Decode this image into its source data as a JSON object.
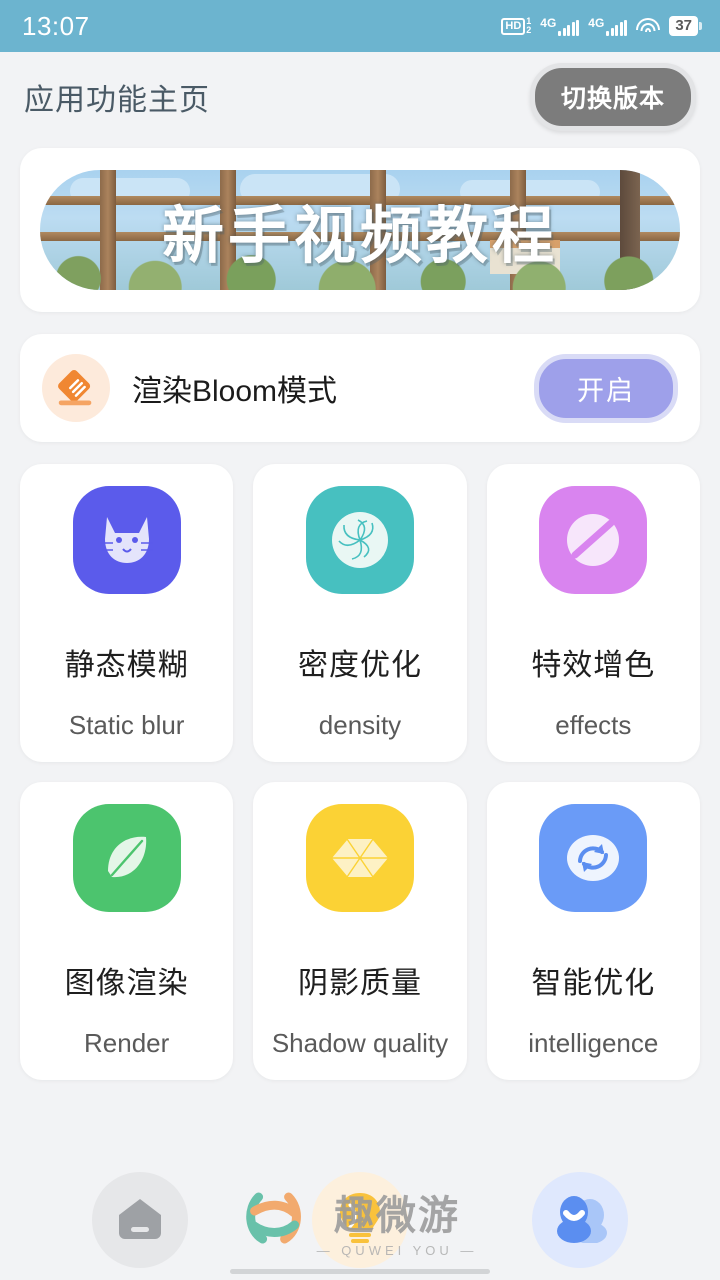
{
  "status_bar": {
    "time": "13:07",
    "hd_label": "HD",
    "hd_sup": "1",
    "hd_sub": "2",
    "sim1_network": "4G",
    "sim2_network": "4G",
    "wifi_icon": "wifi-icon",
    "battery_level": "37"
  },
  "header": {
    "title": "应用功能主页",
    "switch_version_label": "切换版本"
  },
  "banner": {
    "title": "新手视频教程"
  },
  "bloom_row": {
    "icon": "bloom-diamond-icon",
    "label": "渲染Bloom模式",
    "action_label": "开启"
  },
  "features": [
    {
      "icon": "cat-face-icon",
      "icon_color": "#5b5beb",
      "title": "静态模糊",
      "subtitle": "Static blur"
    },
    {
      "icon": "swirl-icon",
      "icon_color": "#47c0c0",
      "title": "密度优化",
      "subtitle": "density"
    },
    {
      "icon": "no-effects-icon",
      "icon_color": "#d984ef",
      "title": "特效增色",
      "subtitle": "effects"
    },
    {
      "icon": "leaf-icon",
      "icon_color": "#4cc46e",
      "title": "图像渲染",
      "subtitle": "Render"
    },
    {
      "icon": "gem-icon",
      "icon_color": "#fbd235",
      "title": "阴影质量",
      "subtitle": "Shadow quality"
    },
    {
      "icon": "sync-icon",
      "icon_color": "#6a9bf7",
      "title": "智能优化",
      "subtitle": "intelligence"
    }
  ],
  "bottom_nav": [
    {
      "icon": "home-icon",
      "name": "nav-home"
    },
    {
      "icon": "lightbulb-icon",
      "name": "nav-tips"
    },
    {
      "icon": "people-icon",
      "name": "nav-chat"
    }
  ],
  "watermark": {
    "logo": "quweiyou-knot-logo",
    "text": "趣微游",
    "subtext": "— QUWEI YOU —"
  },
  "colors": {
    "status_bar_bg": "#6cb4cf",
    "page_bg": "#f2f3f5",
    "card_bg": "#ffffff",
    "title_color": "#4a5a66",
    "version_btn_bg": "#7c7c7c",
    "bloom_btn_bg": "#9ea0ea",
    "bloom_icon_bg": "#fdeadb",
    "bloom_icon_fg": "#f08732"
  }
}
